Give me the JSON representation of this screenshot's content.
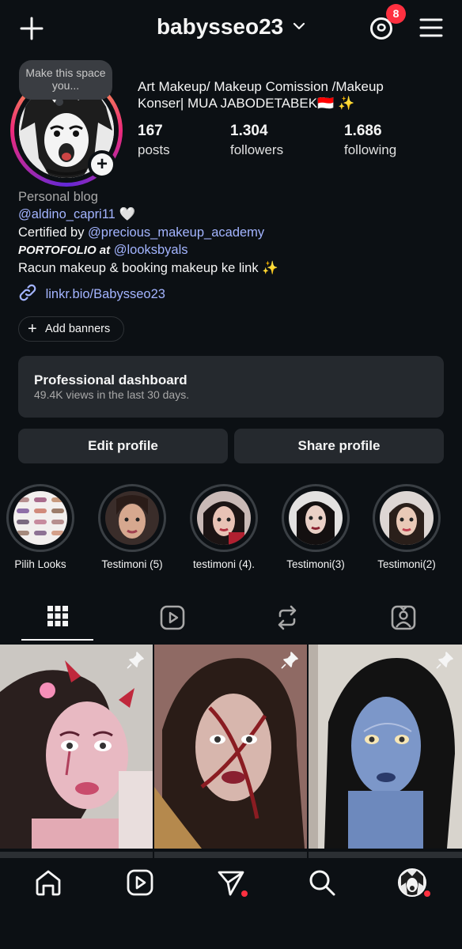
{
  "header": {
    "username": "babysseo23",
    "notification_count": "8"
  },
  "note": {
    "text": "Make this space you..."
  },
  "profile": {
    "headline": "Art Makeup/ Makeup Comission /Makeup Konser| MUA JABODETABEK🇮🇩 ✨",
    "stats": [
      {
        "value": "167",
        "label": "posts"
      },
      {
        "value": "1.304",
        "label": "followers"
      },
      {
        "value": "1.686",
        "label": "following"
      }
    ],
    "category": "Personal blog",
    "bio_line1_link": "@aldino_capri11",
    "bio_line1_emoji": "🤍",
    "bio_line2_prefix": "Certified by",
    "bio_line2_link": "@precious_makeup_academy",
    "bio_line3_prefix": "PORTOFOLIO at",
    "bio_line3_link": "@looksbyals",
    "bio_line4": "Racun makeup & booking makeup ke link ✨",
    "website": "linkr.bio/Babysseo23"
  },
  "add_banners_label": "Add banners",
  "dashboard": {
    "title": "Professional dashboard",
    "subtitle": "49.4K views in the last 30 days."
  },
  "buttons": {
    "edit": "Edit profile",
    "share": "Share profile"
  },
  "highlights": [
    {
      "label": "Pilih Looks"
    },
    {
      "label": "Testimoni (5)"
    },
    {
      "label": "testimoni (4)."
    },
    {
      "label": "Testimoni(3)"
    },
    {
      "label": "Testimoni(2)"
    }
  ],
  "tabs": [
    "grid-icon",
    "reels-icon",
    "reposts-icon",
    "tagged-icon"
  ],
  "bottom_nav": [
    "home-icon",
    "reels-icon",
    "messages-icon",
    "search-icon",
    "profile-avatar"
  ],
  "colors": {
    "background": "#0c1014",
    "card": "#25292e",
    "link": "#a3b4ff",
    "badge": "#ff3040"
  }
}
